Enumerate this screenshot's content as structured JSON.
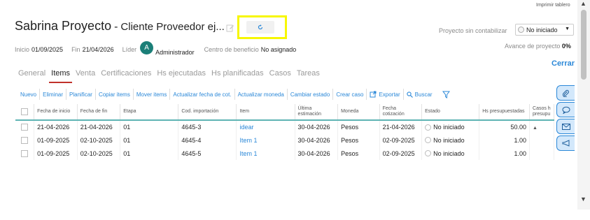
{
  "print_link": "Imprimir tablero",
  "title": {
    "main": "Sabrina Proyecto",
    "dash": "-",
    "sub": "Cliente Proveedor ej..."
  },
  "project_status": {
    "label": "Proyecto sin contabilizar",
    "value": "No iniciado"
  },
  "info": {
    "inicio_label": "Inicio",
    "inicio_value": "01/09/2025",
    "fin_label": "Fin",
    "fin_value": "21/04/2026",
    "lider_label": "Líder",
    "lider_avatar": "A",
    "lider_name": "Administrador",
    "centro_label": "Centro de beneficio",
    "centro_value": "No asignado",
    "avance_label": "Avance de proyecto",
    "avance_value": "0%"
  },
  "close_label": "Cerrar",
  "tabs": [
    {
      "label": "General",
      "active": false
    },
    {
      "label": "Items",
      "active": true
    },
    {
      "label": "Venta",
      "active": false
    },
    {
      "label": "Certificaciones",
      "active": false
    },
    {
      "label": "Hs ejecutadas",
      "active": false
    },
    {
      "label": "Hs planificadas",
      "active": false
    },
    {
      "label": "Casos",
      "active": false
    },
    {
      "label": "Tareas",
      "active": false
    }
  ],
  "toolbar": {
    "nuevo": "Nuevo",
    "eliminar": "Eliminar",
    "planificar": "Planificar",
    "copiar": "Copiar items",
    "mover": "Mover items",
    "actualizar_fecha": "Actualizar fecha de cot.",
    "actualizar_moneda": "Actualizar moneda",
    "cambiar_estado": "Cambiar estado",
    "crear_caso": "Crear caso",
    "exportar": "Exportar",
    "buscar": "Buscar"
  },
  "table": {
    "headers": {
      "fecha_inicio": "Fecha de inicio",
      "fecha_fin": "Fecha de fin",
      "etapa": "Etapa",
      "cod": "Cod. importación",
      "item": "Item",
      "ultima": "Última estimación",
      "moneda": "Moneda",
      "fecha_cot": "Fecha cotización",
      "estado": "Estado",
      "hs_presup": "Hs presupuestadas",
      "casos": "Casos h presupu"
    },
    "rows": [
      {
        "fecha_inicio": "21-04-2026",
        "fecha_fin": "21-04-2026",
        "etapa": "01",
        "cod": "4645-3",
        "item": "idear",
        "ultima": "30-04-2026",
        "moneda": "Pesos",
        "fecha_cot": "21-04-2026",
        "estado": "No iniciado",
        "hs": "50.00"
      },
      {
        "fecha_inicio": "01-09-2025",
        "fecha_fin": "02-10-2025",
        "etapa": "01",
        "cod": "4645-4",
        "item": "Item 1",
        "ultima": "30-04-2026",
        "moneda": "Pesos",
        "fecha_cot": "02-09-2025",
        "estado": "No iniciado",
        "hs": "1.00"
      },
      {
        "fecha_inicio": "01-09-2025",
        "fecha_fin": "02-10-2025",
        "etapa": "01",
        "cod": "4645-5",
        "item": "Item 1",
        "ultima": "30-04-2026",
        "moneda": "Pesos",
        "fecha_cot": "02-09-2025",
        "estado": "No iniciado",
        "hs": "1.00"
      }
    ]
  },
  "side_tabs": [
    "paperclip-icon",
    "chat-icon",
    "mail-icon",
    "megaphone-icon"
  ],
  "colors": {
    "link": "#2b88d8",
    "active_tab_underline": "#c0312b",
    "avatar": "#1b7f78",
    "highlight": "#f7f700",
    "table_header_border": "#5eb4b4"
  }
}
